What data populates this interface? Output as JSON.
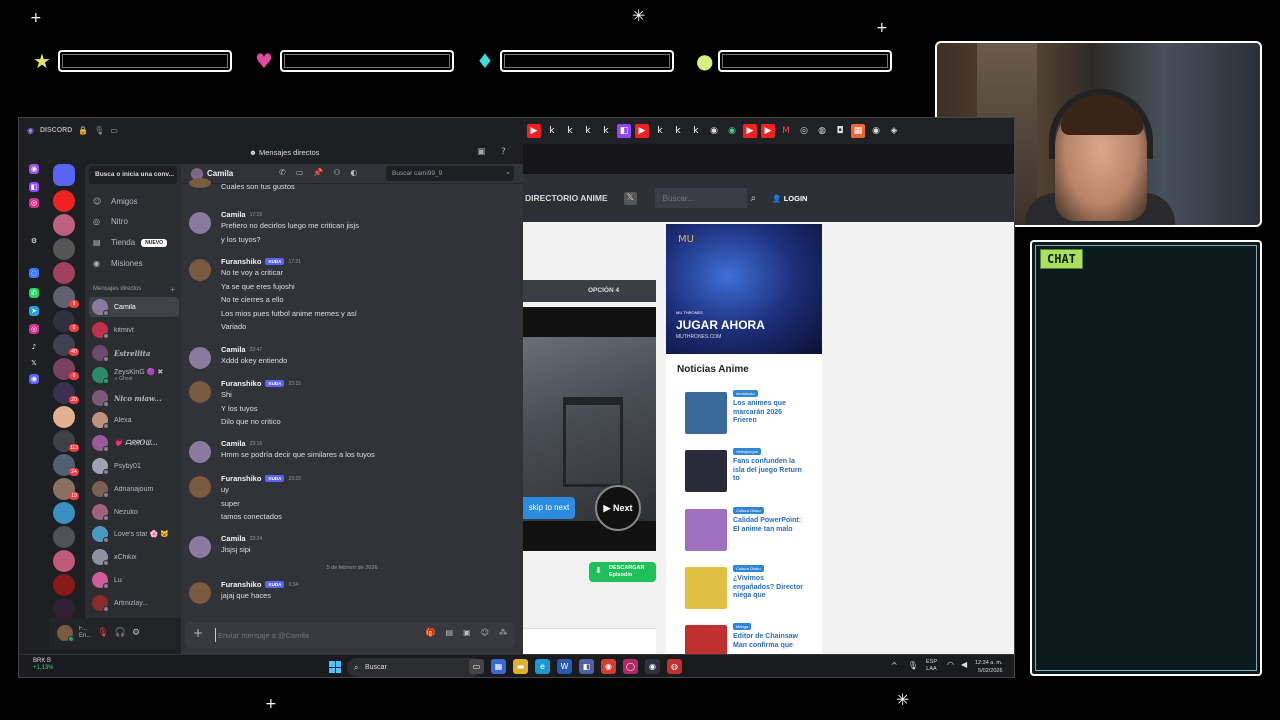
{
  "overlay": {
    "sparkles": [
      "+",
      "✳",
      "+",
      "✳",
      "+"
    ],
    "bar_icons": [
      {
        "name": "star",
        "glyph": "★",
        "color": "#e8e070"
      },
      {
        "name": "heart",
        "glyph": "♥",
        "color": "#e04aa0"
      },
      {
        "name": "diamond",
        "glyph": "♦",
        "color": "#40d8d8"
      },
      {
        "name": "circle",
        "glyph": "●",
        "color": "#d8f080"
      }
    ],
    "chat_label": "CHAT"
  },
  "discord": {
    "app_name": "DISCORD",
    "topbar_title": "Mensajes directos",
    "dm_search": "Busca o inicia una conv...",
    "nav": [
      {
        "label": "Amigos",
        "icon": "friends-icon",
        "glyph": "☺"
      },
      {
        "label": "Nitro",
        "icon": "nitro-icon",
        "glyph": "◎"
      },
      {
        "label": "Tienda",
        "icon": "shop-icon",
        "glyph": "▤",
        "badge": "NUEVO"
      },
      {
        "label": "Misiones",
        "icon": "quests-icon",
        "glyph": "◉"
      }
    ],
    "dm_header": "Mensajes directos",
    "dms": [
      {
        "name": "Camila",
        "color": "#8a7aa0",
        "active": true
      },
      {
        "name": "kitmivt",
        "color": "#c0304a"
      },
      {
        "name": "Estrellita",
        "color": "#6a4a6a",
        "italic": true
      },
      {
        "name": "ZeysKinG 🟣 ✖",
        "sub": "♫ Ghost",
        "color": "#2a8a6a"
      },
      {
        "name": "Nico miaw...",
        "color": "#7a5a7a",
        "italic": true
      },
      {
        "name": "Alexa",
        "color": "#c09080"
      },
      {
        "name": "💗 ᗩᖇᖇOᗯ...",
        "color": "#9a5a9a"
      },
      {
        "name": "Psyby01",
        "color": "#a0a0b0"
      },
      {
        "name": "Adrianajoum",
        "color": "#7a6050"
      },
      {
        "name": "Nezuko",
        "color": "#a06080"
      },
      {
        "name": "Love's star 🌸 🐱",
        "color": "#4a9ac0"
      },
      {
        "name": "xChikix",
        "color": "#9090a0"
      },
      {
        "name": "Lu",
        "color": "#d05a9a"
      },
      {
        "name": "Artmizlay...",
        "color": "#8a2a2a"
      }
    ],
    "user": {
      "name": "F...",
      "status": "En..."
    },
    "chat": {
      "channel": "Camila",
      "search_placeholder": "Buscar cami99_9",
      "messages": [
        {
          "author": "",
          "lines": [
            "Cuales son tus gustos"
          ],
          "cont": true,
          "av": "#7a5a40"
        },
        {
          "author": "Camila",
          "time": "17:15",
          "lines": [
            "Prefiero no decirlos luego me critican jisjs",
            "y los tuyos?"
          ],
          "av": "#8a7aa0"
        },
        {
          "author": "Furanshiko",
          "tag": "KUDA",
          "time": "17:21",
          "lines": [
            "No te voy a criticar",
            "Ya se que eres fujoshi",
            "No te cierres a ello",
            "Los mios pues futbol anime memes y así",
            "Variado"
          ],
          "av": "#7a5a40"
        },
        {
          "author": "Camila",
          "time": "22:47",
          "lines": [
            "Xddd okey entiendo"
          ],
          "av": "#8a7aa0"
        },
        {
          "author": "Furanshiko",
          "tag": "KUDA",
          "time": "23:15",
          "lines": [
            "Shi",
            "Y los tuyos",
            "Dilo que no critico"
          ],
          "av": "#7a5a40"
        },
        {
          "author": "Camila",
          "time": "23:16",
          "lines": [
            "Hmm se podría decir que similares a los tuyos"
          ],
          "av": "#8a7aa0"
        },
        {
          "author": "Furanshiko",
          "tag": "KUDA",
          "time": "23:23",
          "lines": [
            "uy",
            "super",
            "tamos conectados"
          ],
          "av": "#7a5a40"
        },
        {
          "author": "Camila",
          "time": "23:24",
          "lines": [
            "Jisjsj sipi"
          ],
          "av": "#8a7aa0"
        },
        {
          "date": "5 de febrero de 2026"
        },
        {
          "author": "Furanshiko",
          "tag": "KUDA",
          "time": "0:34",
          "lines": [
            "jajaj que haces"
          ],
          "av": "#7a5a40"
        }
      ],
      "composer_placeholder": "Enviar mensaje a @Camila"
    }
  },
  "site": {
    "nav_link": "DIRECTORIO ANIME",
    "search_placeholder": "Buscar...",
    "login": "LOGIN",
    "player_tab": "OPCIÓN 4",
    "skip": "skip to next",
    "next": "▶ Next",
    "download": "DESCARGAR",
    "download_sub": "Episodio",
    "ad_logo": "MU",
    "ad_tag": "MU THRONES",
    "ad_title": "JUGAR AHORA",
    "ad_sub": "MUTHRONES.COM",
    "news_title": "Noticias Anime",
    "news": [
      {
        "cat": "demoboku",
        "title": "Los animes que marcarán 2026 Frieren",
        "thumb": "#3a6a9a"
      },
      {
        "cat": "Videojuegos",
        "title": "Fans confunden la isla del juego Return to",
        "thumb": "#2a2a3a"
      },
      {
        "cat": "Cultura Otaku",
        "title": "Calidad PowerPoint: El anime tan malo",
        "thumb": "#a070c0"
      },
      {
        "cat": "Cultura Otaku",
        "title": "¿Vivimos engañados? Director niega que",
        "thumb": "#e0c040"
      },
      {
        "cat": "Manga",
        "title": "Editor de Chainsaw Man confirma que",
        "thumb": "#c03030"
      }
    ]
  },
  "taskbar": {
    "stock_name": "BRK B",
    "stock_change": "+1,13%",
    "search": "Buscar",
    "lang": [
      "ESP",
      "LAA"
    ],
    "time": "12:34 a. m.",
    "date": "5/02/2026"
  }
}
